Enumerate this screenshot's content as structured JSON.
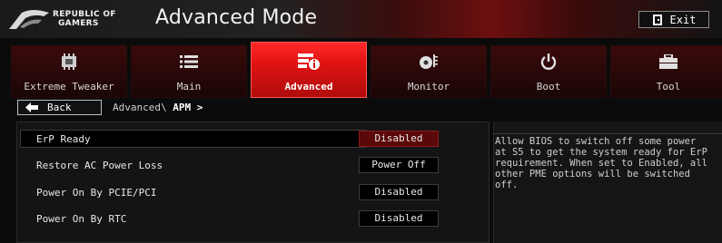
{
  "header": {
    "logo_line1": "REPUBLIC OF",
    "logo_line2": "GAMERS",
    "mode_title": "Advanced Mode",
    "exit_label": "Exit"
  },
  "tabs": [
    {
      "label": "Extreme Tweaker",
      "icon": "cpu-chip-icon",
      "active": false
    },
    {
      "label": "Main",
      "icon": "list-icon",
      "active": false
    },
    {
      "label": "Advanced",
      "icon": "advanced-info-icon",
      "active": true
    },
    {
      "label": "Monitor",
      "icon": "fan-monitor-icon",
      "active": false
    },
    {
      "label": "Boot",
      "icon": "power-icon",
      "active": false
    },
    {
      "label": "Tool",
      "icon": "toolbox-icon",
      "active": false
    }
  ],
  "nav": {
    "back_label": "Back",
    "breadcrumb_prefix": "Advanced\\ ",
    "breadcrumb_current": "APM >"
  },
  "settings": [
    {
      "label": "ErP Ready",
      "value": "Disabled",
      "selected": true
    },
    {
      "label": "Restore AC Power Loss",
      "value": "Power Off",
      "selected": false
    },
    {
      "label": "Power On By PCIE/PCI",
      "value": "Disabled",
      "selected": false
    },
    {
      "label": "Power On By RTC",
      "value": "Disabled",
      "selected": false
    }
  ],
  "help": {
    "text": "Allow BIOS to switch off some power\nat S5 to get the system ready for ErP\nrequirement. When set to Enabled, all\nother PME options will be switched\noff."
  },
  "colors": {
    "accent": "#e31414",
    "selected_value_bg": "#5a0808",
    "background": "#0b0b0b"
  }
}
